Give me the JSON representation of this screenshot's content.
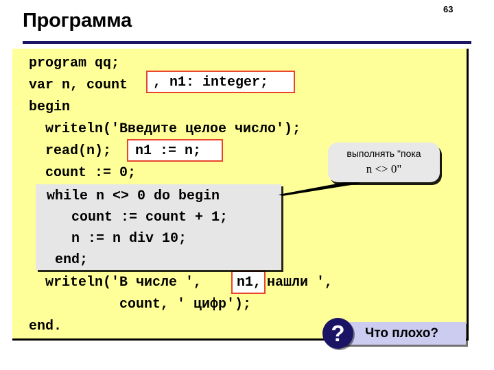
{
  "slide": {
    "number": "63",
    "title": "Программа",
    "accent_color": "#1b1464",
    "panel_color": "#ffff99",
    "highlight_border_color": "#e8452c",
    "inset_color": "#e6e6e6"
  },
  "code": {
    "lines": [
      {
        "text": "program qq;"
      },
      {
        "text": "var n, count"
      },
      {
        "text": "begin"
      },
      {
        "text": "  writeln('Введите целое число');"
      },
      {
        "text": "  read(n);"
      },
      {
        "text": "  count := 0;"
      },
      {
        "text": "  writeln('В числе ',",
        "suffix": "' нашли ',"
      },
      {
        "text": "           count, ' цифр');"
      },
      {
        "text": "end."
      }
    ]
  },
  "highlights": {
    "var_decl": ", n1: integer;",
    "assign_n1": "n1 := n;",
    "writeln_n1": "n1,"
  },
  "while_block": {
    "lines": [
      "while n <> 0 do begin",
      "   count := count + 1;",
      "   n := n div 10;",
      " end;"
    ]
  },
  "callout": {
    "line1": "выполнять \"пока",
    "line2": "n <> 0\""
  },
  "question": {
    "icon": "?",
    "label": "Что плохо?"
  }
}
